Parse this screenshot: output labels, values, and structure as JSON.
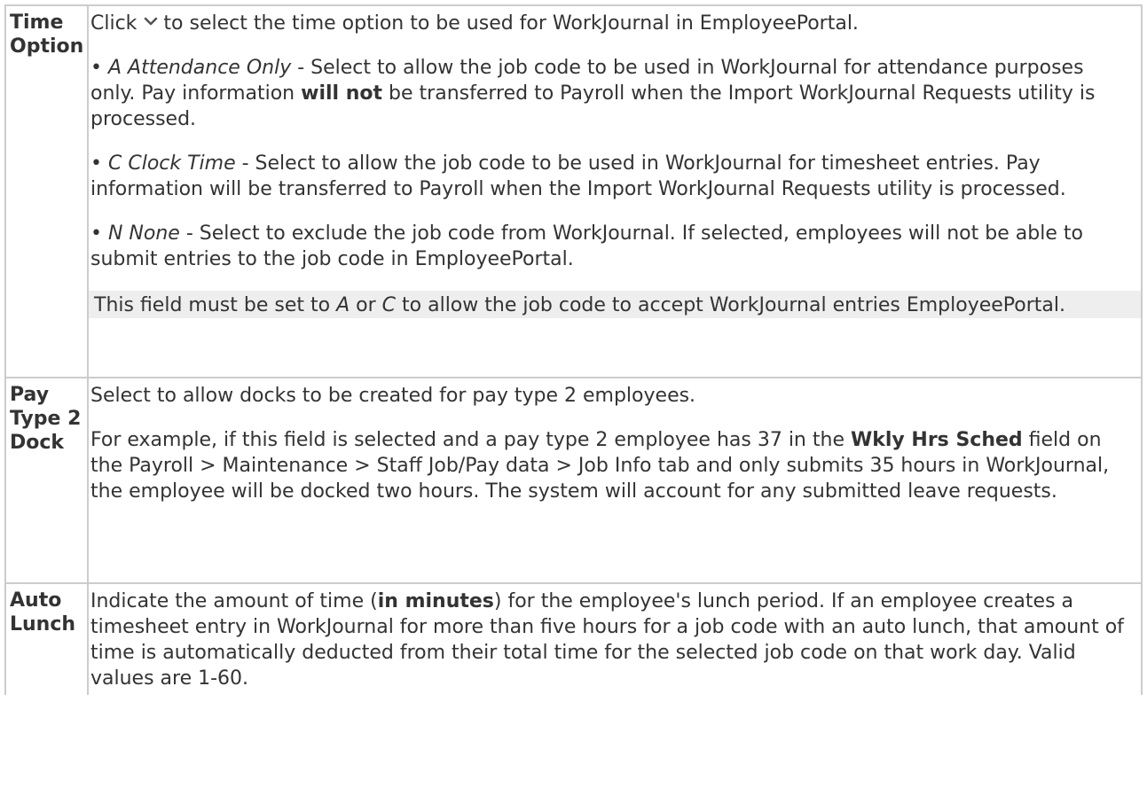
{
  "rows": [
    {
      "term": "Time Option",
      "intro_before": "Click",
      "intro_after": "to select the time option to be used for WorkJournal in EmployeePortal.",
      "icon": "chevron-down-icon",
      "options": [
        {
          "bullet": "•",
          "code": "A Attendance Only",
          "text_before": "- Select to allow the job code to be used in WorkJournal for attendance purposes only. Pay information",
          "bold": "will not",
          "text_after": "be transferred to Payroll when the Import WorkJournal Requests utility is processed."
        },
        {
          "bullet": "•",
          "code": "C Clock Time",
          "text": "- Select to allow the job code to be used in WorkJournal for timesheet entries. Pay information will be transferred to Payroll when the Import WorkJournal Requests utility is processed."
        },
        {
          "bullet": "•",
          "code": "N None",
          "text": "- Select to exclude the job code from WorkJournal. If selected, employees will not be able to submit entries to the job code in EmployeePortal."
        }
      ],
      "note": {
        "before": "This field must be set to",
        "a": "A",
        "or": "or",
        "c": "C",
        "after": "to allow the job code to accept WorkJournal entries EmployeePortal."
      }
    },
    {
      "term": "Pay Type 2 Dock",
      "para1": "Select to allow docks to be created for pay type 2 employees.",
      "para2_before": "For example, if this field is selected and a pay type 2 employee has 37 in the",
      "para2_bold": "Wkly Hrs Sched",
      "para2_after": "field on the Payroll > Maintenance > Staff Job/Pay data > Job Info tab and only submits 35 hours in WorkJournal, the employee will be docked two hours. The system will account for any submitted leave requests."
    },
    {
      "term": "Auto Lunch",
      "before": "Indicate the amount of time (",
      "bold": "in minutes",
      "after": ") for the employee's lunch period. If an employee creates a timesheet entry in WorkJournal for more than five hours for a job code with an auto lunch, that amount of time is automatically deducted from their total time for the selected job code on that work day. Valid values are 1-60."
    }
  ],
  "colors": {
    "text": "#333333",
    "border": "#cccccc",
    "note_background": "#eeeeee"
  }
}
